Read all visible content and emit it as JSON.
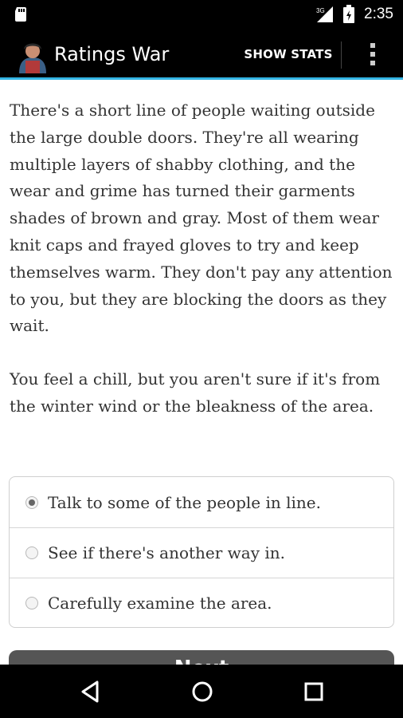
{
  "status_bar": {
    "time": "2:35",
    "network_label": "3G",
    "icons": [
      "sd-card-icon",
      "signal-icon",
      "battery-icon"
    ]
  },
  "app_bar": {
    "title": "Ratings War",
    "show_stats_label": "SHOW STATS",
    "icons": [
      "app-icon",
      "overflow-menu-icon"
    ],
    "accent_color": "#33b5e5"
  },
  "story": {
    "paragraphs": [
      "There's a short line of people waiting outside the large double doors. They're all wearing multiple layers of shabby clothing, and the wear and grime has turned their garments shades of brown and gray. Most of them wear knit caps and frayed gloves to try and keep themselves warm. They don't pay any attention to you, but they are blocking the doors as they wait.",
      "You feel a chill, but you aren't sure if it's from the winter wind or the bleakness of the area."
    ]
  },
  "choices": [
    {
      "label": "Talk to some of the people in line.",
      "selected": true
    },
    {
      "label": "See if there's another way in.",
      "selected": false
    },
    {
      "label": "Carefully examine the area.",
      "selected": false
    }
  ],
  "next_button": {
    "label": "Next"
  },
  "nav_bar": {
    "icons": [
      "back-icon",
      "home-icon",
      "recents-icon"
    ]
  }
}
